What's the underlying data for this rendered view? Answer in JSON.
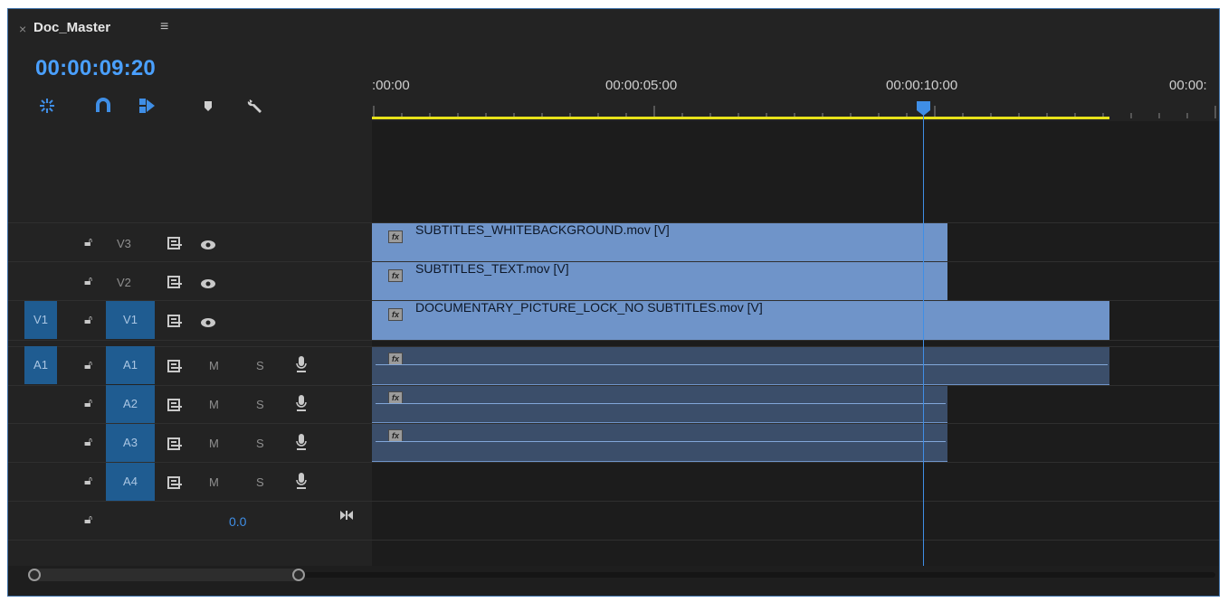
{
  "panel": {
    "close_glyph": "×",
    "sequence_name": "Doc_Master",
    "menu_glyph": "≡",
    "timecode": "00:00:09:20"
  },
  "tools": [
    {
      "name": "insert-nest-icon"
    },
    {
      "name": "snap-magnet-icon"
    },
    {
      "name": "linked-selection-icon"
    },
    {
      "name": "add-marker-icon"
    },
    {
      "name": "wrench-settings-icon"
    }
  ],
  "ruler": {
    "labels": [
      ":00:00",
      "00:00:05:00",
      "00:00:10:00",
      "00:00:"
    ]
  },
  "video_tracks": [
    {
      "source": "",
      "target": "V3",
      "targeted": false
    },
    {
      "source": "",
      "target": "V2",
      "targeted": false
    },
    {
      "source": "V1",
      "target": "V1",
      "targeted": true
    }
  ],
  "audio_tracks": [
    {
      "source": "A1",
      "target": "A1",
      "mute": "M",
      "solo": "S"
    },
    {
      "source": "",
      "target": "A2",
      "mute": "M",
      "solo": "S"
    },
    {
      "source": "",
      "target": "A3",
      "mute": "M",
      "solo": "S"
    },
    {
      "source": "",
      "target": "A4",
      "mute": "M",
      "solo": "S"
    }
  ],
  "master": {
    "volume": "0.0"
  },
  "clips": {
    "v3": "SUBTITLES_WHITEBACKGROUND.mov [V]",
    "v2": "SUBTITLES_TEXT.mov [V]",
    "v1": "DOCUMENTARY_PICTURE_LOCK_NO SUBTITLES.mov [V]",
    "fx_label": "fx"
  },
  "colors": {
    "timecode": "#4aa0ff",
    "video_clip": "#6f94c9",
    "audio_clip": "#3b4e6a",
    "track_target": "#1f5c91",
    "work_area": "#e7e21a",
    "playhead": "#3f8ee6"
  }
}
